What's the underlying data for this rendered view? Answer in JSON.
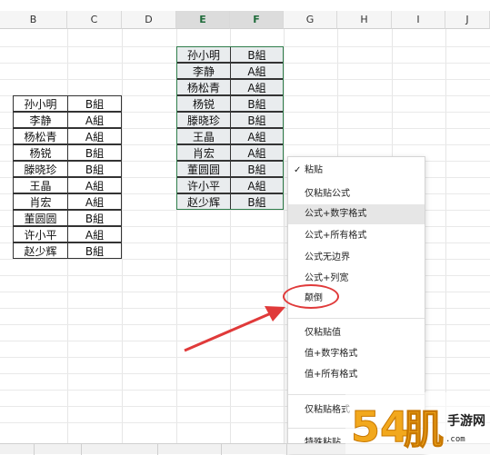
{
  "columns": [
    "B",
    "C",
    "D",
    "E",
    "F",
    "G",
    "H",
    "I",
    "J"
  ],
  "left_table": [
    [
      "孙小明",
      "B組"
    ],
    [
      "李静",
      "A組"
    ],
    [
      "杨松青",
      "A組"
    ],
    [
      "杨锐",
      "B組"
    ],
    [
      "滕晓珍",
      "B組"
    ],
    [
      "王晶",
      "A組"
    ],
    [
      "肖宏",
      "A組"
    ],
    [
      "董圆圆",
      "B組"
    ],
    [
      "许小平",
      "A組"
    ],
    [
      "赵少辉",
      "B組"
    ]
  ],
  "pasted_table": [
    [
      "孙小明",
      "B組"
    ],
    [
      "李静",
      "A組"
    ],
    [
      "杨松青",
      "A組"
    ],
    [
      "杨锐",
      "B組"
    ],
    [
      "滕晓珍",
      "B組"
    ],
    [
      "王晶",
      "A組"
    ],
    [
      "肖宏",
      "A組"
    ],
    [
      "董圆圆",
      "B組"
    ],
    [
      "许小平",
      "A組"
    ],
    [
      "赵少辉",
      "B組"
    ]
  ],
  "paste_menu": {
    "checked_item": "粘贴",
    "items": [
      "粘贴",
      "仅粘贴公式",
      "公式+数字格式",
      "公式+所有格式",
      "公式无边界",
      "公式+列宽",
      "颠倒",
      "仅粘贴值",
      "值+数字格式",
      "值+所有格式",
      "仅粘贴格式",
      "特殊粘贴"
    ],
    "highlighted_item": "公式+数字格式",
    "circled_item": "颠倒"
  },
  "annotation": {
    "arrow_color": "#e03a3a",
    "circle_color": "#e03a3a"
  },
  "colors": {
    "selection_border": "#2e7d4a",
    "selected_header": "#dcdcdc"
  }
}
